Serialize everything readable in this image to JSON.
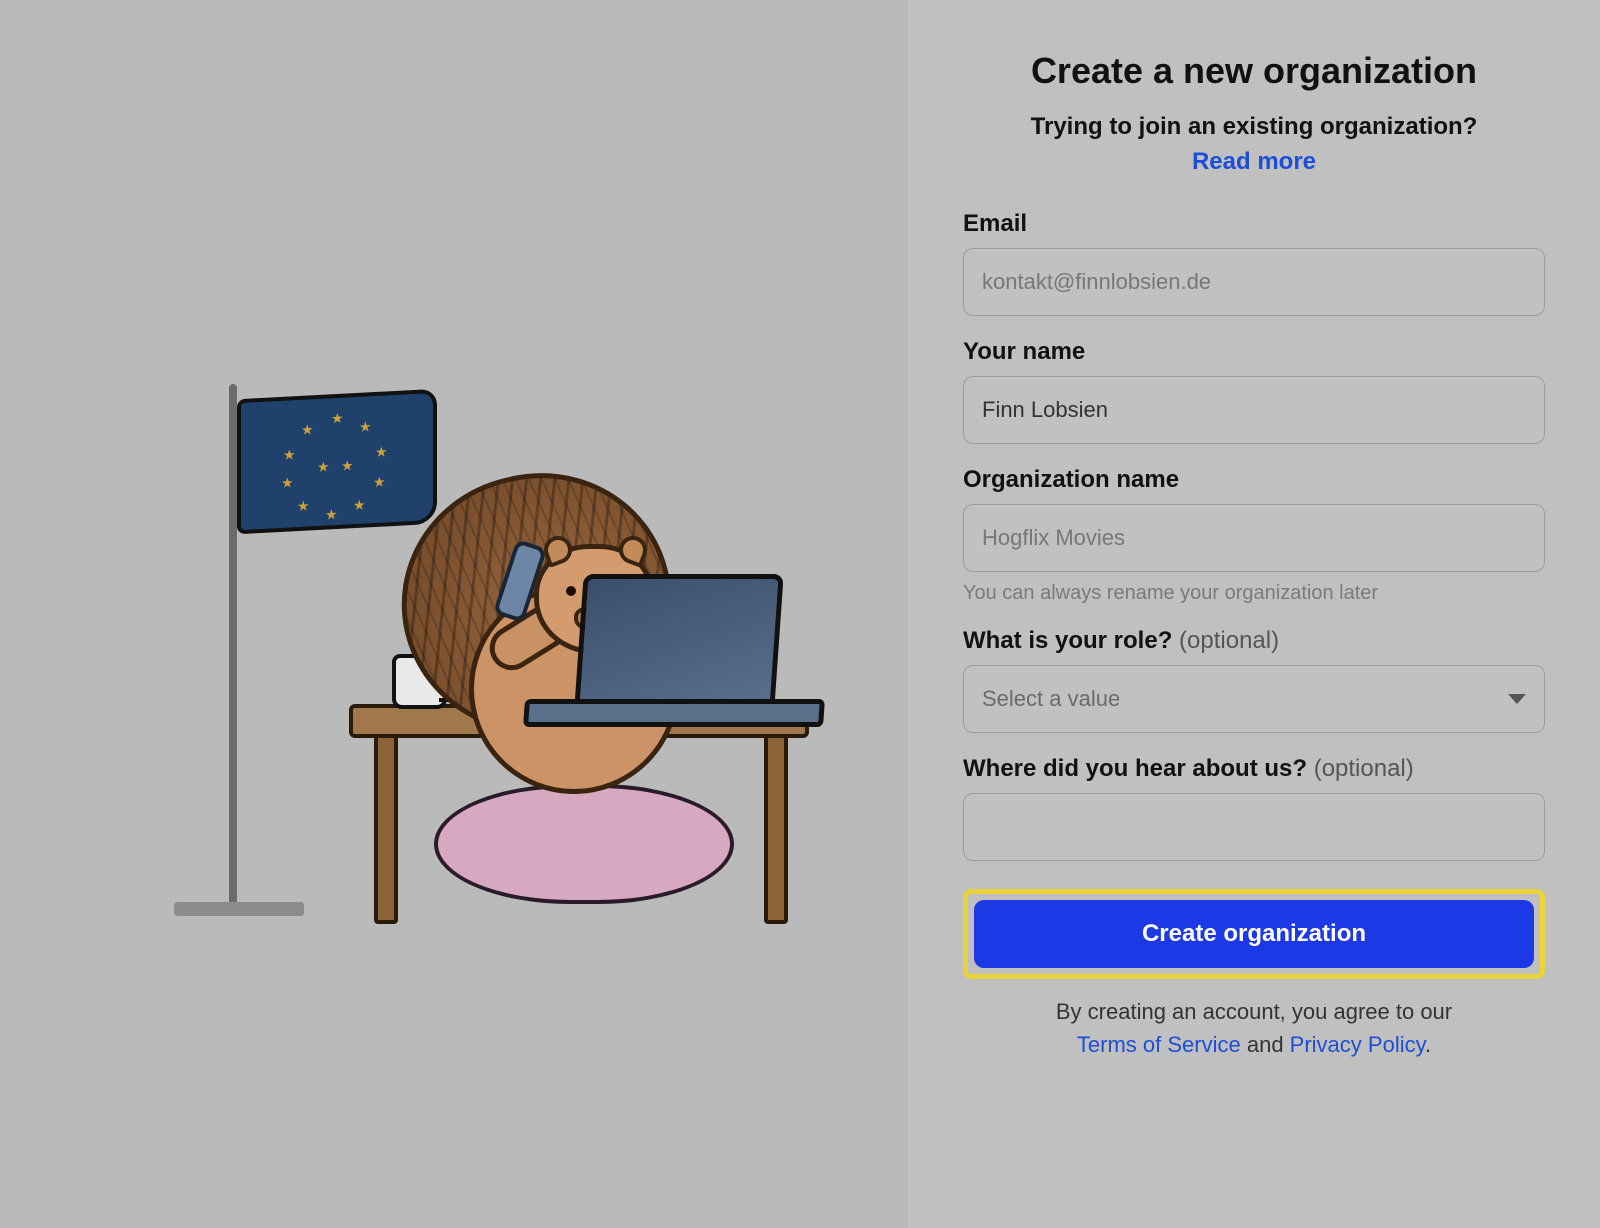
{
  "title": "Create a new organization",
  "subtitle_question": "Trying to join an existing organization?",
  "subtitle_link": "Read more",
  "fields": {
    "email": {
      "label": "Email",
      "value": "kontakt@finnlobsien.de"
    },
    "name": {
      "label": "Your name",
      "value": "Finn Lobsien"
    },
    "org": {
      "label": "Organization name",
      "placeholder": "Hogflix Movies",
      "helper": "You can always rename your organization later"
    },
    "role": {
      "label": "What is your role?",
      "optional": "(optional)",
      "placeholder": "Select a value"
    },
    "heard": {
      "label": "Where did you hear about us?",
      "optional": "(optional)",
      "value": ""
    }
  },
  "submit_label": "Create organization",
  "legal": {
    "prefix": "By creating an account, you agree to our",
    "tos": "Terms of Service",
    "and": " and ",
    "privacy": "Privacy Policy",
    "suffix": "."
  }
}
